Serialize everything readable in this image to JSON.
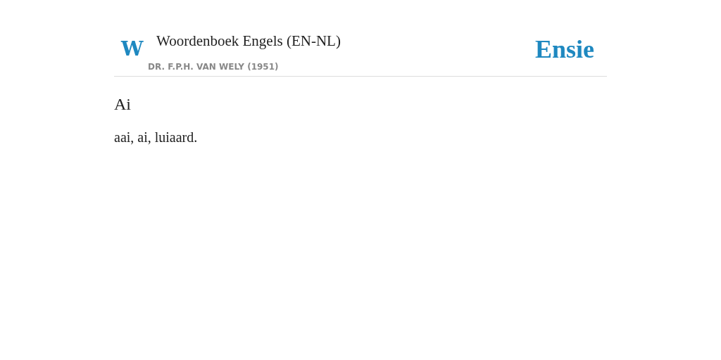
{
  "header": {
    "badge": "W",
    "title": "Woordenboek Engels (EN-NL)",
    "author": "DR. F.P.H. VAN WELY (1951)",
    "logo": "Ensie"
  },
  "entry": {
    "term": "Ai",
    "definition": "aai, ai, luiaard."
  }
}
